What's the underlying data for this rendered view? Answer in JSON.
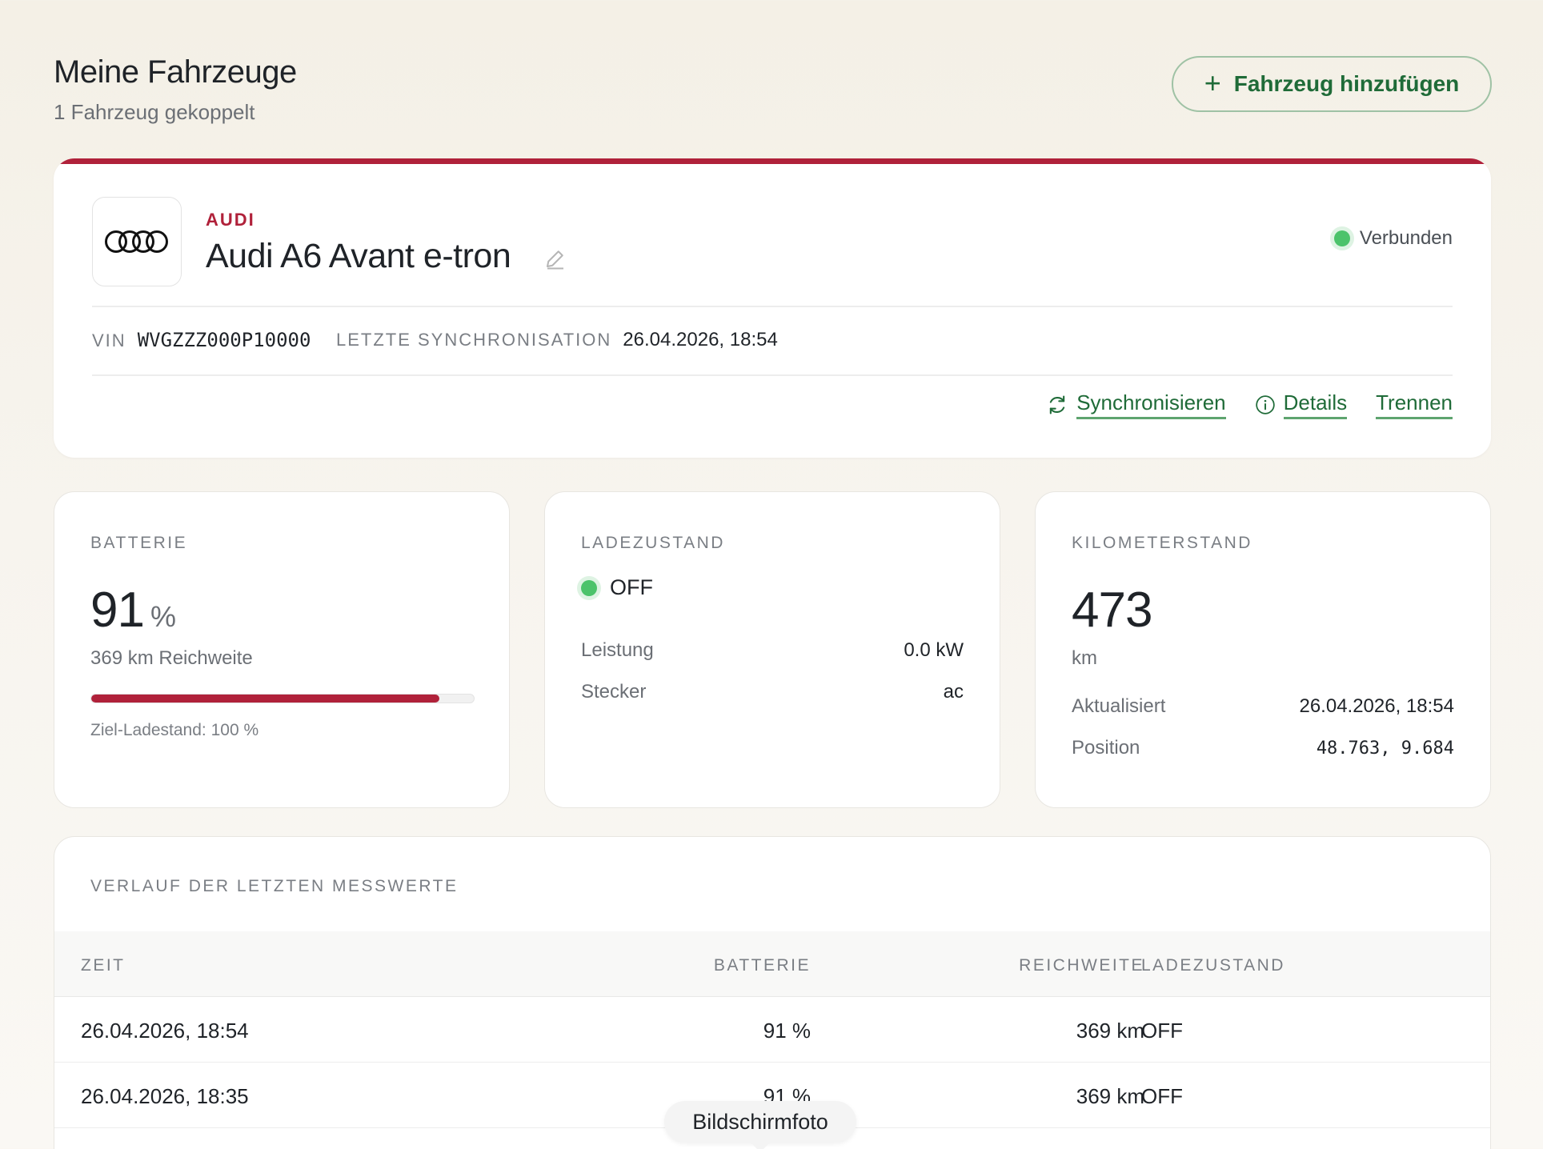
{
  "header": {
    "title": "Meine Fahrzeuge",
    "subtitle": "1 Fahrzeug gekoppelt",
    "add_button": "Fahrzeug hinzufügen"
  },
  "vehicle": {
    "brand": "AUDI",
    "name": "Audi A6 Avant e-tron",
    "status": "Verbunden",
    "vin_label": "VIN",
    "vin": "WVGZZZ000P10000",
    "sync_label": "LETZTE SYNCHRONISATION",
    "sync_time": "26.04.2026, 18:54",
    "actions": {
      "sync": "Synchronisieren",
      "details": "Details",
      "disconnect": "Trennen"
    }
  },
  "battery": {
    "label": "BATTERIE",
    "value": "91",
    "unit": "%",
    "level_fraction": 0.91,
    "range": "369 km Reichweite",
    "target": "Ziel-Ladestand: 100 %"
  },
  "charging": {
    "label": "LADEZUSTAND",
    "state": "OFF",
    "power_label": "Leistung",
    "power": "0.0 kW",
    "plug_label": "Stecker",
    "plug": "ac"
  },
  "odometer": {
    "label": "KILOMETERSTAND",
    "value": "473",
    "unit": "km",
    "updated_label": "Aktualisiert",
    "updated": "26.04.2026, 18:54",
    "position_label": "Position",
    "position": "48.763, 9.684"
  },
  "history": {
    "title": "VERLAUF DER LETZTEN MESSWERTE",
    "columns": [
      "ZEIT",
      "BATTERIE",
      "REICHWEITE",
      "LADEZUSTAND"
    ],
    "rows": [
      [
        "26.04.2026, 18:54",
        "91 %",
        "369 km",
        "OFF"
      ],
      [
        "26.04.2026, 18:35",
        "91 %",
        "369 km",
        "OFF"
      ]
    ]
  },
  "overlay": {
    "label": "Bildschirmfoto"
  },
  "colors": {
    "accent": "#b0213a",
    "primary_green": "#1f6b38",
    "status_green": "#4cc36b"
  }
}
